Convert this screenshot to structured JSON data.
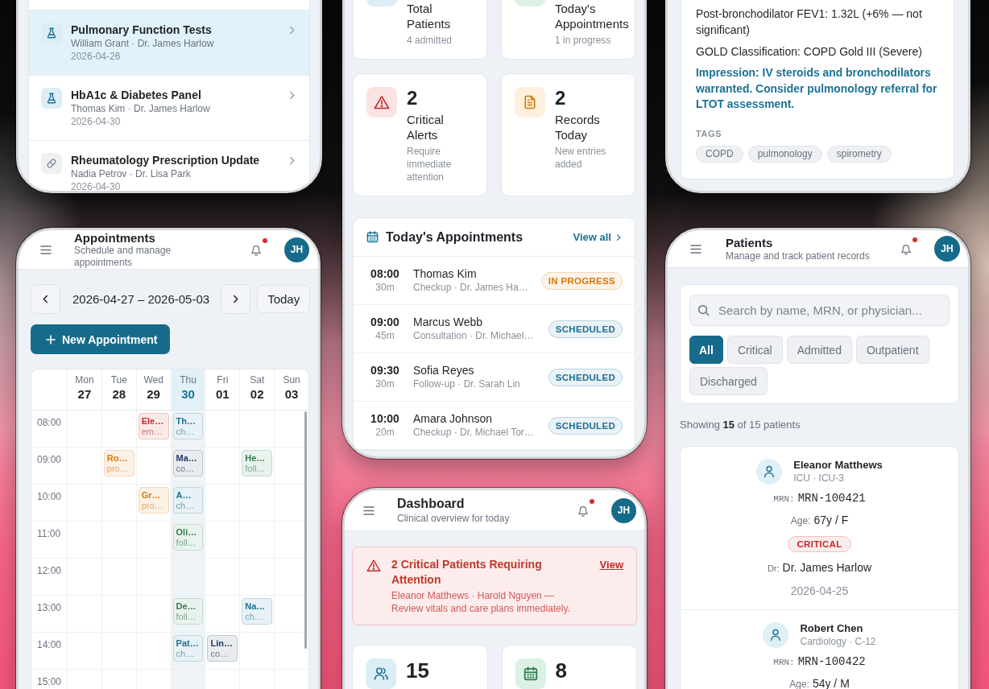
{
  "lab_orders_screen": {
    "orders": [
      {
        "kind": "lab",
        "title": "Pulmonary Function Tests",
        "meta": "William Grant · Dr. James Harlow",
        "date": "2026-04-26",
        "selected": true
      },
      {
        "kind": "lab",
        "title": "HbA1c & Diabetes Panel",
        "meta": "Thomas Kim · Dr. James Harlow",
        "date": "2026-04-30",
        "selected": false
      },
      {
        "kind": "prescription",
        "title": "Rheumatology Prescription Update",
        "meta": "Nadia Petrov · Dr. Lisa Park",
        "date": "2026-04-30",
        "selected": false
      }
    ]
  },
  "dashboard_stats_screen": {
    "stat_cards": [
      {
        "kind": "patients",
        "label": "Total Patients",
        "note": "4 admitted"
      },
      {
        "kind": "appointments",
        "label": "Today's Appointments",
        "note": "1 in progress"
      },
      {
        "kind": "alerts",
        "value": "2",
        "label": "Critical Alerts",
        "note": "Require immediate attention"
      },
      {
        "kind": "records",
        "value": "2",
        "label": "Records Today",
        "note": "New entries added"
      }
    ],
    "appointments_card": {
      "title": "Today's Appointments",
      "link": "View all",
      "rows": [
        {
          "time": "08:00",
          "duration": "30m",
          "patient": "Thomas Kim",
          "detail": "Checkup · Dr. James Ha…",
          "status": "IN PROGRESS",
          "color": "#d97706"
        },
        {
          "time": "09:00",
          "duration": "45m",
          "patient": "Marcus Webb",
          "detail": "Consultation · Dr. Michael…",
          "status": "SCHEDULED",
          "color": "#1a6f94"
        },
        {
          "time": "09:30",
          "duration": "30m",
          "patient": "Sofia Reyes",
          "detail": "Follow-up · Dr. Sarah Lin",
          "status": "SCHEDULED",
          "color": "#1a6f94"
        },
        {
          "time": "10:00",
          "duration": "20m",
          "patient": "Amara Johnson",
          "detail": "Checkup · Dr. Michael Tor…",
          "status": "SCHEDULED",
          "color": "#1a6f94"
        }
      ]
    }
  },
  "record_detail_screen": {
    "findings": [
      "Post-bronchodilator FEV1: 1.32L (+6% — not significant)",
      "GOLD Classification: COPD Gold III (Severe)"
    ],
    "impression": "Impression: IV steroids and bronchodilators warranted. Consider pulmonology referral for LTOT assessment.",
    "tags_label": "TAGS",
    "tags": [
      "COPD",
      "pulmonology",
      "spirometry"
    ]
  },
  "appointments_screen": {
    "header": {
      "title": "Appointments",
      "subtitle": "Schedule and manage appointments",
      "unread": true,
      "avatar": "JH"
    },
    "week_range": "2026-04-27 – 2026-05-03",
    "today_button": "Today",
    "new_button": "New Appointment",
    "days": [
      {
        "name": "Mon",
        "date": "27",
        "selected": false
      },
      {
        "name": "Tue",
        "date": "28",
        "selected": false
      },
      {
        "name": "Wed",
        "date": "29",
        "selected": false
      },
      {
        "name": "Thu",
        "date": "30",
        "selected": true
      },
      {
        "name": "Fri",
        "date": "01",
        "selected": false
      },
      {
        "name": "Sat",
        "date": "02",
        "selected": false
      },
      {
        "name": "Sun",
        "date": "03",
        "selected": false
      }
    ],
    "rows": [
      {
        "time": "08:00",
        "cells": [
          null,
          null,
          {
            "title": "Ele…",
            "detail": "em…",
            "color": "#c62828"
          },
          {
            "title": "Th…",
            "detail": "ch…",
            "color": "#1a7396"
          },
          null,
          null,
          null
        ]
      },
      {
        "time": "09:00",
        "cells": [
          null,
          {
            "title": "Ro…",
            "detail": "pro…",
            "color": "#d97706"
          },
          null,
          {
            "title": "Ma…",
            "detail": "co…",
            "color": "#1e3a5f"
          },
          null,
          {
            "title": "He…",
            "detail": "foll…",
            "color": "#2e7d4f"
          },
          null
        ]
      },
      {
        "time": "10:00",
        "cells": [
          null,
          null,
          {
            "title": "Gr…",
            "detail": "pro…",
            "color": "#d97706"
          },
          {
            "title": "A…",
            "detail": "ch…",
            "color": "#1a7396"
          },
          null,
          null,
          null
        ]
      },
      {
        "time": "11:00",
        "cells": [
          null,
          null,
          null,
          {
            "title": "Oli…",
            "detail": "foll…",
            "color": "#2e7d4f"
          },
          null,
          null,
          null
        ]
      },
      {
        "time": "12:00",
        "cells": [
          null,
          null,
          null,
          null,
          null,
          null,
          null
        ]
      },
      {
        "time": "13:00",
        "cells": [
          null,
          null,
          null,
          {
            "title": "De…",
            "detail": "foll…",
            "color": "#2e7d4f"
          },
          null,
          {
            "title": "Na…",
            "detail": "ch…",
            "color": "#1a7396"
          },
          null
        ]
      },
      {
        "time": "14:00",
        "cells": [
          null,
          null,
          null,
          {
            "title": "Pat…",
            "detail": "ch…",
            "color": "#1a7396"
          },
          {
            "title": "Lin…",
            "detail": "co…",
            "color": "#1e3a5f"
          },
          null,
          null
        ]
      },
      {
        "time": "15:00",
        "cells": [
          null,
          null,
          null,
          null,
          null,
          null,
          null
        ]
      }
    ]
  },
  "dashboard_screen": {
    "header": {
      "title": "Dashboard",
      "subtitle": "Clinical overview for today",
      "unread": true,
      "avatar": "JH"
    },
    "alert": {
      "title": "2 Critical Patients Requiring Attention",
      "body": "Eleanor Matthews · Harold Nguyen — Review vitals and care plans immediately.",
      "link": "View"
    },
    "stat_cards": [
      {
        "kind": "patients",
        "value": "15"
      },
      {
        "kind": "appointments",
        "value": "8"
      }
    ]
  },
  "patients_screen": {
    "header": {
      "title": "Patients",
      "subtitle": "Manage and track patient records",
      "unread": true,
      "avatar": "JH"
    },
    "search": {
      "placeholder": "Search by name, MRN, or physician..."
    },
    "filters": [
      {
        "label": "All",
        "selected": true
      },
      {
        "label": "Critical",
        "selected": false
      },
      {
        "label": "Admitted",
        "selected": false
      },
      {
        "label": "Outpatient",
        "selected": false
      },
      {
        "label": "Discharged",
        "selected": false
      }
    ],
    "summary": "Showing **15** of 15 patients",
    "patients": [
      {
        "name": "Eleanor Matthews",
        "location": "ICU · ICU-3",
        "mrn_label": "MRN:",
        "mrn": "MRN-100421",
        "age_label": "Age:",
        "age": "67y / F",
        "status": "CRITICAL",
        "color": "#c62828",
        "physician_label": "Dr:",
        "physician": "Dr. James Harlow",
        "date": "2026-04-25"
      },
      {
        "name": "Robert Chen",
        "location": "Cardiology · C-12",
        "mrn_label": "MRN:",
        "mrn": "MRN-100422",
        "age_label": "Age:",
        "age": "54y / M"
      }
    ]
  }
}
